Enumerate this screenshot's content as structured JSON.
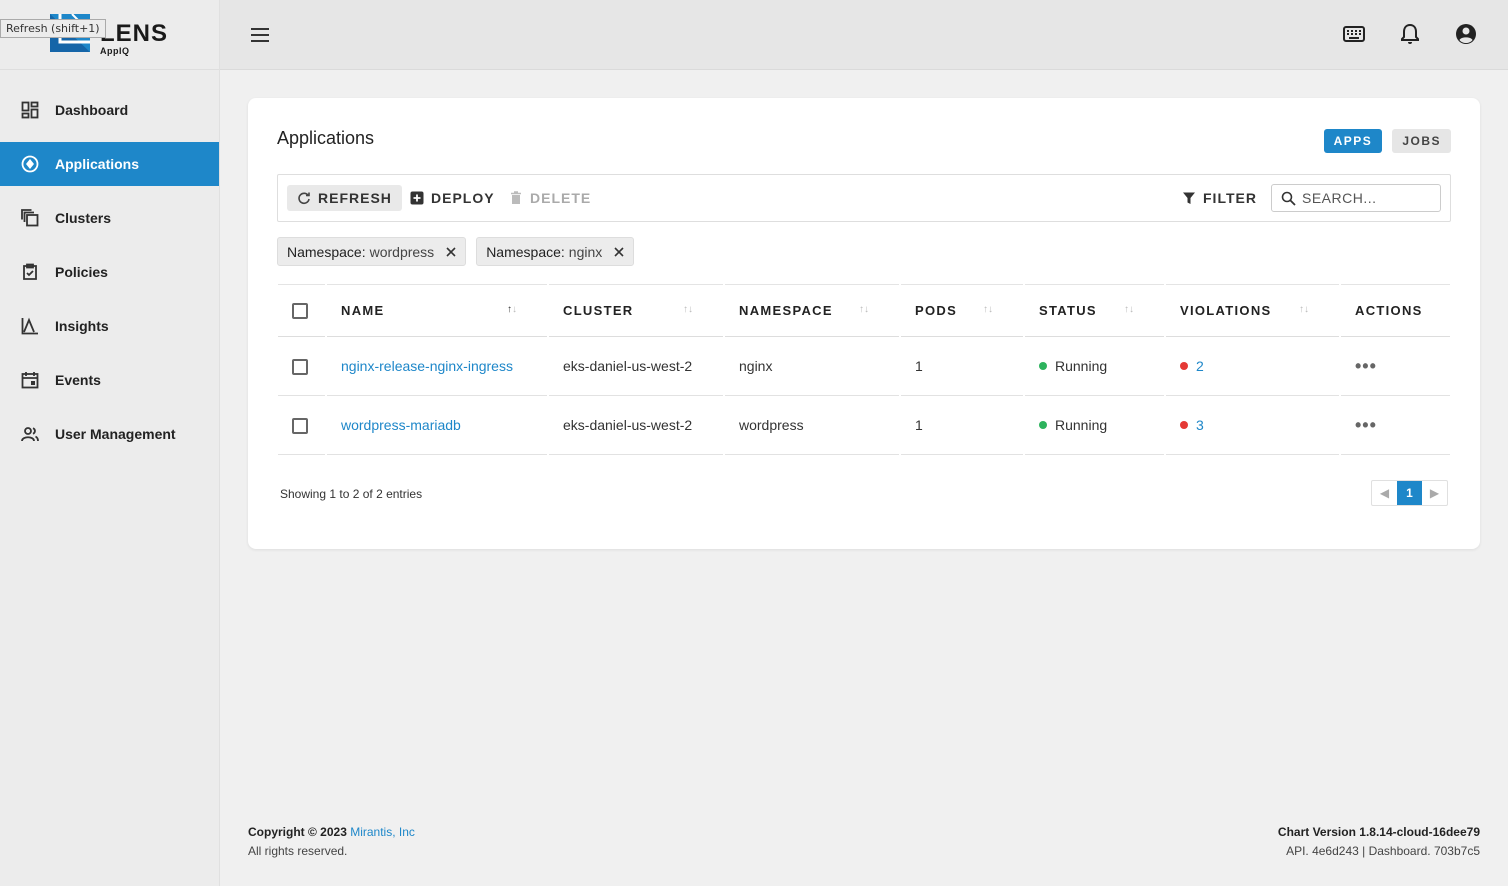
{
  "tooltip": "Refresh (shift+1)",
  "brand": {
    "name": "LENS",
    "sub": "AppIQ",
    "colors": {
      "accent": "#1e87c9",
      "running": "#2db35d",
      "violation": "#e53935"
    }
  },
  "sidebar": {
    "items": [
      {
        "label": "Dashboard",
        "icon": "dashboard-icon"
      },
      {
        "label": "Applications",
        "icon": "applications-icon",
        "active": true
      },
      {
        "label": "Clusters",
        "icon": "clusters-icon"
      },
      {
        "label": "Policies",
        "icon": "policies-icon"
      },
      {
        "label": "Insights",
        "icon": "insights-icon"
      },
      {
        "label": "Events",
        "icon": "events-icon"
      },
      {
        "label": "User Management",
        "icon": "users-icon"
      }
    ]
  },
  "topbar": {
    "icons": [
      "menu-icon",
      "keyboard-icon",
      "bell-icon",
      "account-icon"
    ]
  },
  "main": {
    "title": "Applications",
    "tabs": {
      "apps": "APPS",
      "jobs": "JOBS"
    },
    "toolbar": {
      "refresh": "REFRESH",
      "deploy": "DEPLOY",
      "delete": "DELETE",
      "filter": "FILTER",
      "search_placeholder": "SEARCH..."
    },
    "chips": [
      {
        "key": "Namespace:",
        "value": "wordpress"
      },
      {
        "key": "Namespace:",
        "value": "nginx"
      }
    ],
    "table": {
      "columns": [
        "NAME",
        "CLUSTER",
        "NAMESPACE",
        "PODS",
        "STATUS",
        "VIOLATIONS",
        "ACTIONS"
      ],
      "rows": [
        {
          "name": "nginx-release-nginx-ingress",
          "cluster": "eks-daniel-us-west-2",
          "namespace": "nginx",
          "pods": "1",
          "status": "Running",
          "violations": "2"
        },
        {
          "name": "wordpress-mariadb",
          "cluster": "eks-daniel-us-west-2",
          "namespace": "wordpress",
          "pods": "1",
          "status": "Running",
          "violations": "3"
        }
      ]
    },
    "entries": "Showing 1 to 2 of 2 entries",
    "pagination": {
      "current": "1"
    }
  },
  "footer": {
    "copyright": "Copyright © 2023",
    "company": "Mirantis, Inc",
    "rights": "All rights reserved.",
    "chart_version": "Chart Version 1.8.14-cloud-16dee79",
    "api": "API. 4e6d243 | Dashboard. 703b7c5"
  }
}
